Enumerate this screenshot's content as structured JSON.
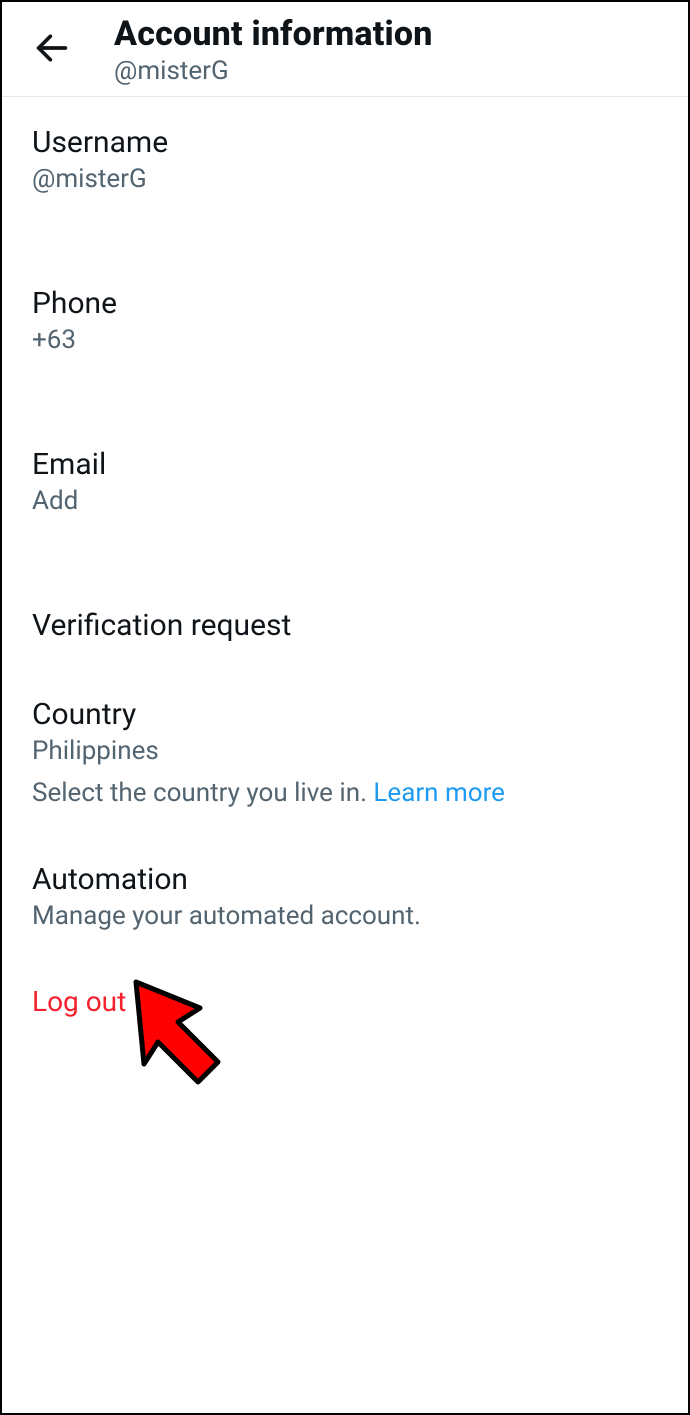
{
  "header": {
    "title": "Account information",
    "subtitle": "@misterG"
  },
  "items": {
    "username": {
      "label": "Username",
      "value": "@misterG"
    },
    "phone": {
      "label": "Phone",
      "value": "+63"
    },
    "email": {
      "label": "Email",
      "value": "Add"
    },
    "verification": {
      "label": "Verification request"
    },
    "country": {
      "label": "Country",
      "value": "Philippines"
    },
    "country_help": {
      "text": "Select the country you live in. ",
      "link": "Learn more"
    },
    "automation": {
      "label": "Automation",
      "value": "Manage your automated account."
    }
  },
  "logout": {
    "label": "Log out"
  },
  "overlay": {
    "arrow_color": "#ff0000",
    "arrow_stroke": "#000000"
  }
}
